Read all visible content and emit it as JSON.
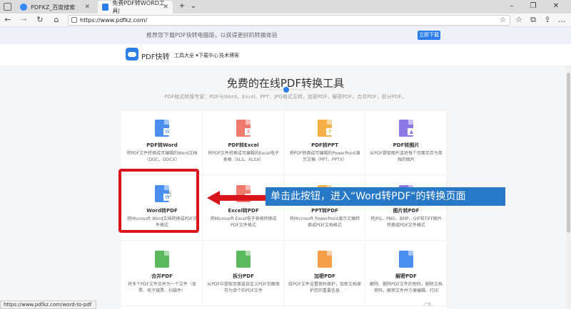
{
  "browser": {
    "tabs": [
      {
        "title": "PDFKZ_百度搜索",
        "active": false
      },
      {
        "title": "免费PDF转WORD工具|",
        "active": true
      }
    ],
    "new_tab": "+",
    "tab_menu": "⌄",
    "close_glyph": "✕",
    "window_controls": {
      "minimize": "–",
      "maximize": "❐",
      "close": "✕"
    },
    "nav": {
      "back": "←",
      "forward": "→",
      "refresh": "↻",
      "home": "⌂",
      "star": "☆",
      "favorites": "☆",
      "collections": "⧉",
      "share": "⇪",
      "more": "…"
    },
    "url": "https://www.pdfkz.com/"
  },
  "promo": {
    "text": "推荐您下载PDF快转电脑版，以获得更好的转换体验",
    "button": "立即下载"
  },
  "header": {
    "logo_text": "PDF快转",
    "links": [
      "工具大全 ▾",
      "下载中心",
      "技术博客"
    ]
  },
  "main": {
    "title": "免费的在线PDF转换工具",
    "subtitle": "PDF格式转换专家：PDF与Word、Excel、PPT、JPG格式互转，加密PDF，解密PDF，合并PDF，拆分PDF。"
  },
  "tools": [
    {
      "name": "PDF转Word",
      "desc": "将PDF文件转换成可编辑的Word文档（DOC、DOCX）",
      "color": "#4a8ef0",
      "letter": "W"
    },
    {
      "name": "PDF转Excel",
      "desc": "将PDF文件转换成可编辑的Excel电子表格（XLS、XLSX）",
      "color": "#f07a6e",
      "letter": "E"
    },
    {
      "name": "PDF转PPT",
      "desc": "将PDF转换成可编辑的PowerPoint演示文稿（PPT、PPTX）",
      "color": "#f5b048",
      "letter": "P"
    },
    {
      "name": "PDF转图片",
      "desc": "从PDF提取图片或将每个页面另存为单独的图片",
      "color": "#8e78e8",
      "letter": "▲"
    },
    {
      "name": "Word转PDF",
      "desc": "将Microsoft Word文档转换成PDF文件格式",
      "color": "#4a8ef0",
      "letter": "W"
    },
    {
      "name": "Excel转PDF",
      "desc": "将Microsoft Excel电子表格转换成PDF文件格式",
      "color": "#f07a6e",
      "letter": "E"
    },
    {
      "name": "PPT转PDF",
      "desc": "将Microsoft PowerPoint演示文稿转换成PDF文档格式",
      "color": "#f5b048",
      "letter": "P"
    },
    {
      "name": "图片转PDF",
      "desc": "将JPG、PNG、BMP、GIF和TIFF图片转换成PDF文件格式",
      "color": "#8e78e8",
      "letter": "▲"
    },
    {
      "name": "合并PDF",
      "desc": "将多个PDF文件合并为一个文件（发票、电子银票、扫描件）",
      "color": "#5cb85c",
      "letter": ""
    },
    {
      "name": "拆分PDF",
      "desc": "从PDF中提取页面或自定义PDF页面保存为单个的PDF文件",
      "color": "#5cb85c",
      "letter": ""
    },
    {
      "name": "加密PDF",
      "desc": "给PDF文件设置密码保护，加密文档保护您的重要信息",
      "color": "#f5a048",
      "letter": ""
    },
    {
      "name": "解密PDF",
      "desc": "解除、删除PDF文件的密码，删除文档密码，解密文件并方便编辑、打印",
      "color": "#4a8ef0",
      "letter": ""
    }
  ],
  "annotation": {
    "callout": "单击此按钮，进入“Word转PDF“的转换页面",
    "arrow_color": "#d9141b"
  },
  "status": {
    "hover_url": "https://www.pdfkz.com/word-to-pdf",
    "ad_label": "广告"
  }
}
